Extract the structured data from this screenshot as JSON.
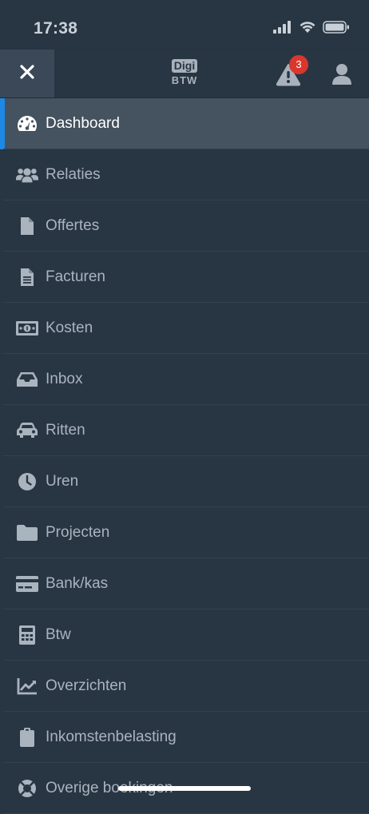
{
  "status_bar": {
    "time": "17:38"
  },
  "header": {
    "logo_top": "Digi",
    "logo_bottom": "BTW",
    "notification_count": "3"
  },
  "menu": {
    "items": [
      {
        "label": "Dashboard",
        "icon": "dashboard-gauge-icon",
        "active": true
      },
      {
        "label": "Relaties",
        "icon": "users-icon",
        "active": false
      },
      {
        "label": "Offertes",
        "icon": "file-icon",
        "active": false
      },
      {
        "label": "Facturen",
        "icon": "file-text-icon",
        "active": false
      },
      {
        "label": "Kosten",
        "icon": "money-bill-icon",
        "active": false
      },
      {
        "label": "Inbox",
        "icon": "inbox-icon",
        "active": false
      },
      {
        "label": "Ritten",
        "icon": "car-icon",
        "active": false
      },
      {
        "label": "Uren",
        "icon": "clock-icon",
        "active": false
      },
      {
        "label": "Projecten",
        "icon": "folder-icon",
        "active": false
      },
      {
        "label": "Bank/kas",
        "icon": "credit-card-icon",
        "active": false
      },
      {
        "label": "Btw",
        "icon": "calculator-icon",
        "active": false
      },
      {
        "label": "Overzichten",
        "icon": "chart-line-icon",
        "active": false
      },
      {
        "label": "Inkomstenbelasting",
        "icon": "clipboard-icon",
        "active": false
      },
      {
        "label": "Overige boekingen",
        "icon": "life-ring-icon",
        "active": false
      }
    ]
  },
  "colors": {
    "background": "#283543",
    "active_item": "#45525f",
    "accent": "#1e88e5",
    "badge": "#d9372d"
  }
}
